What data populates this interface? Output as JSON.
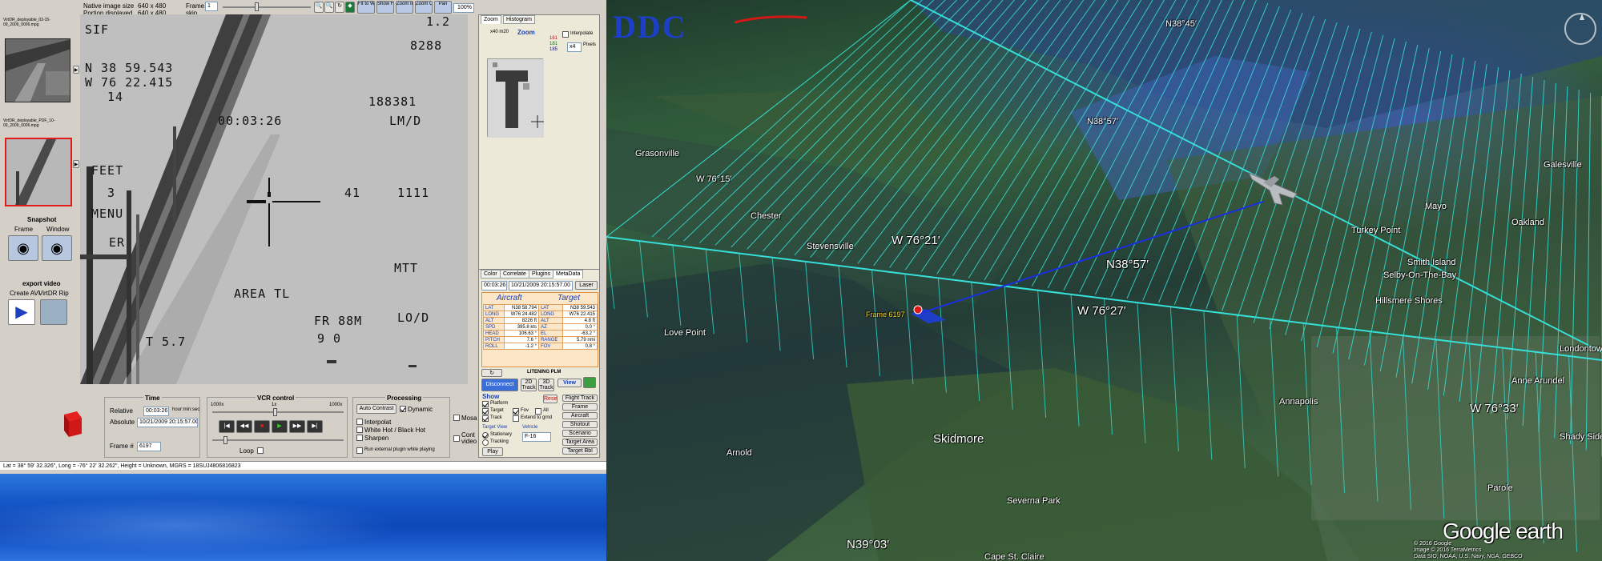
{
  "app": {
    "info": {
      "native_size_label": "Native image size",
      "native_size_value": "640 x 480",
      "portion_label": "Portion displayed",
      "portion_value": "640 x 480",
      "frame_label": "Frame",
      "skip_label": "skip",
      "skip_value": "1"
    },
    "toolbar_buttons": [
      "Fit to Window",
      "Show Full",
      "Zoom In",
      "Zoom Out",
      "Pan"
    ],
    "percent_value": "100%",
    "thumbnails": [
      {
        "caption": "VirtDR_deployable_03-15-09_2009_0006.mpg"
      },
      {
        "caption": "VirtDR_deployable_PDF_10-09_2009_0006.mpg"
      }
    ],
    "snapshot": {
      "title": "Snapshot",
      "frame_label": "Frame",
      "window_label": "Window"
    },
    "export": {
      "title": "export video",
      "avi_label": "Create AVI",
      "kml_label": "VirtDR Rip"
    },
    "osd": {
      "top_left": "SIF",
      "lat": "N 38 59.543",
      "lon": "W 76 22.415",
      "alt": "14",
      "time": "00:03:26",
      "feet": "FEET",
      "feet_val": "3",
      "menu": "MENU",
      "er": "ER",
      "top_right": "1.2",
      "right_num": "8288",
      "code": "188381",
      "lmd": "LM/D",
      "sel": "41",
      "sel2": "1111",
      "mtt": "MTT",
      "area": "AREA TL",
      "fr": "FR 88M",
      "fr2": "9 0",
      "lod": "LO/D",
      "t": "T 5.7"
    },
    "zoom_panel": {
      "tabs": [
        "Zoom",
        "Histogram"
      ],
      "size_label": "x40 m20",
      "zoom_label": "Zoom",
      "vals": [
        "161",
        "181",
        "185"
      ],
      "interp_label": "Interpolate",
      "pixels_label": "Pixels",
      "zoom_factor": "x4"
    },
    "meta_panel": {
      "tabs": [
        "Color",
        "Correlate",
        "Plugins",
        "MetaData"
      ],
      "time_rel": "00:03:26",
      "date_abs": "10/21/2009 20:15:57.00",
      "laser_btn": "Laser",
      "aircraft_title": "Aircraft",
      "target_title": "Target",
      "rows": [
        {
          "k": "LAT",
          "a": "N38 58.794",
          "k2": "LAT",
          "t": "N38 59.543"
        },
        {
          "k": "LONG",
          "a": "W76 24.482",
          "k2": "LONG",
          "t": "W76 22.415"
        },
        {
          "k": "ALT",
          "a": "8226 ft",
          "k2": "ALT",
          "t": "4.8 ft"
        },
        {
          "k": "SPD",
          "a": "395.8 kts",
          "k2": "AZ",
          "t": "0.0 °"
        },
        {
          "k": "HEAD",
          "a": "106.63 °",
          "k2": "EL",
          "t": "-63.2 °"
        },
        {
          "k": "PITCH",
          "a": "7.6 °",
          "k2": "RANGE",
          "t": "5.79 nmi"
        },
        {
          "k": "ROLL",
          "a": "-1.2 °",
          "k2": "FOV",
          "t": "0.8 °"
        }
      ],
      "pod_label": "LITENING PLM",
      "disconnect_btn": "Disconnect",
      "btn_2d": "2D",
      "btn_2d_sub": "Track",
      "btn_3d": "3D",
      "btn_3d_sub": "Track",
      "view_btn": "View",
      "show_title": "Show",
      "show_platform": "Platform",
      "show_target": "Target",
      "show_track": "Track",
      "show_fov": "Fov",
      "show_all": "All",
      "extend": "Extend to grnd",
      "reset_btn": "Reset",
      "side_btns": [
        "Flight Track",
        "Frame",
        "Aircraft",
        "Shotout",
        "Scenario",
        "Target Area",
        "Target Bbl"
      ],
      "target_view_title": "Target View",
      "tv_stationary": "Stationary",
      "tv_tracking": "Tracking",
      "vehicle_title": "Vehicle",
      "vehicle_value": "F-16",
      "play_btn": "Play"
    },
    "time_box": {
      "title": "Time",
      "rel_label": "Relative",
      "rel_value": "00:03:26",
      "abs_label": "Absolute",
      "abs_value": "10/21/2009 20:15:57.00",
      "frame_label": "Frame #",
      "frame_value": "6197",
      "hms_label": "hour:min:sec"
    },
    "vcr": {
      "title": "VCR control",
      "min_speed": "1000x",
      "mid_speed": "1x",
      "max_speed": "1000x",
      "loop": "Loop"
    },
    "processing": {
      "title": "Processing",
      "auto_contrast": "Auto Contrast",
      "dynamic": "Dynamic",
      "interpolat": "Interpolat",
      "white_hot": "White Hot / Black Hot",
      "sharpen": "Sharpen",
      "run_plugin": "Run external plugin while playing"
    },
    "mosaic": "Mosa",
    "cont_video": "Cont video",
    "status": "Lat = 38° 59' 32.326\", Long = -76° 22' 32.262\", Height = Unknown, MGRS = 18SUJ4806816823"
  },
  "earth": {
    "logo": "DDC",
    "labels": [
      "N38°45'",
      "N38°57'",
      "W 76°15'",
      "W 76°21'",
      "N38°57'",
      "W 76°27'",
      "N39°03'",
      "W 76°33'",
      "Love Point",
      "Skidmore",
      "Annapolis",
      "Hillsmere Shores",
      "Selby-On-The-Bay",
      "Mayo",
      "Chester",
      "Stevensville",
      "Grasonville",
      "Parole",
      "Arnold",
      "Severna Park",
      "Cape St. Claire",
      "Turkey Point",
      "Galesville",
      "Londontown",
      "Anne Arundel",
      "Shady Side",
      "Oakland",
      "Smith Island"
    ],
    "frame_label": "Frame 6197",
    "copyright_1": "© 2016 Google",
    "copyright_2": "Image © 2016 TerraMetrics",
    "copyright_3": "Data SIO, NOAA, U.S. Navy, NGA, GEBCO",
    "brand": "Google earth"
  }
}
